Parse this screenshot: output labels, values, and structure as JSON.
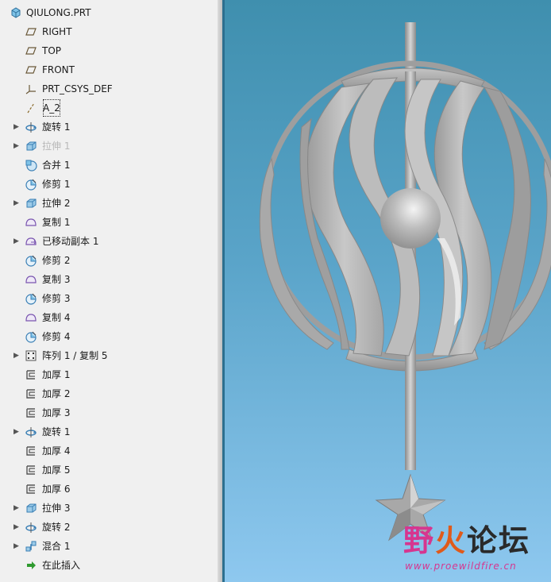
{
  "tree": {
    "root": {
      "label": "QIULONG.PRT",
      "icon": "part-icon"
    },
    "items": [
      {
        "label": "RIGHT",
        "icon": "datum-plane-icon",
        "expandable": false
      },
      {
        "label": "TOP",
        "icon": "datum-plane-icon",
        "expandable": false
      },
      {
        "label": "FRONT",
        "icon": "datum-plane-icon",
        "expandable": false
      },
      {
        "label": "PRT_CSYS_DEF",
        "icon": "coordinate-system-icon",
        "expandable": false
      },
      {
        "label": "A_2",
        "icon": "datum-axis-icon",
        "expandable": false,
        "current": true
      },
      {
        "label": "旋转 1",
        "icon": "revolve-icon",
        "expandable": true
      },
      {
        "label": "拉伸 1",
        "icon": "extrude-icon",
        "expandable": true,
        "suppressed": true
      },
      {
        "label": "合并 1",
        "icon": "merge-icon",
        "expandable": false
      },
      {
        "label": "修剪 1",
        "icon": "trim-icon",
        "expandable": false
      },
      {
        "label": "拉伸 2",
        "icon": "extrude-icon",
        "expandable": true
      },
      {
        "label": "复制 1",
        "icon": "copy-icon",
        "expandable": false
      },
      {
        "label": "已移动副本 1",
        "icon": "moved-copy-icon",
        "expandable": true
      },
      {
        "label": "修剪 2",
        "icon": "trim-icon",
        "expandable": false
      },
      {
        "label": "复制 3",
        "icon": "copy-icon",
        "expandable": false
      },
      {
        "label": "修剪 3",
        "icon": "trim-icon",
        "expandable": false
      },
      {
        "label": "复制 4",
        "icon": "copy-icon",
        "expandable": false
      },
      {
        "label": "修剪 4",
        "icon": "trim-icon",
        "expandable": false
      },
      {
        "label": "阵列 1 / 复制 5",
        "icon": "pattern-icon",
        "expandable": true
      },
      {
        "label": "加厚 1",
        "icon": "thicken-icon",
        "expandable": false
      },
      {
        "label": "加厚 2",
        "icon": "thicken-icon",
        "expandable": false
      },
      {
        "label": "加厚 3",
        "icon": "thicken-icon",
        "expandable": false
      },
      {
        "label": "旋转 1",
        "icon": "revolve-icon",
        "expandable": true
      },
      {
        "label": "加厚 4",
        "icon": "thicken-icon",
        "expandable": false
      },
      {
        "label": "加厚 5",
        "icon": "thicken-icon",
        "expandable": false
      },
      {
        "label": "加厚 6",
        "icon": "thicken-icon",
        "expandable": false
      },
      {
        "label": "拉伸 3",
        "icon": "extrude-icon",
        "expandable": true
      },
      {
        "label": "旋转 2",
        "icon": "revolve-icon",
        "expandable": true
      },
      {
        "label": "混合 1",
        "icon": "blend-icon",
        "expandable": true
      },
      {
        "label": "在此插入",
        "icon": "insert-here-arrow-icon",
        "expandable": false
      }
    ]
  },
  "watermark": {
    "logo_part1": "野",
    "logo_part2": "火",
    "logo_part3": "论坛",
    "url": "www.proewildfire.cn"
  },
  "colors": {
    "viewport_top": "#3f8fae",
    "viewport_bottom": "#8ec8ef",
    "model_gray": "#b4b4b4"
  }
}
